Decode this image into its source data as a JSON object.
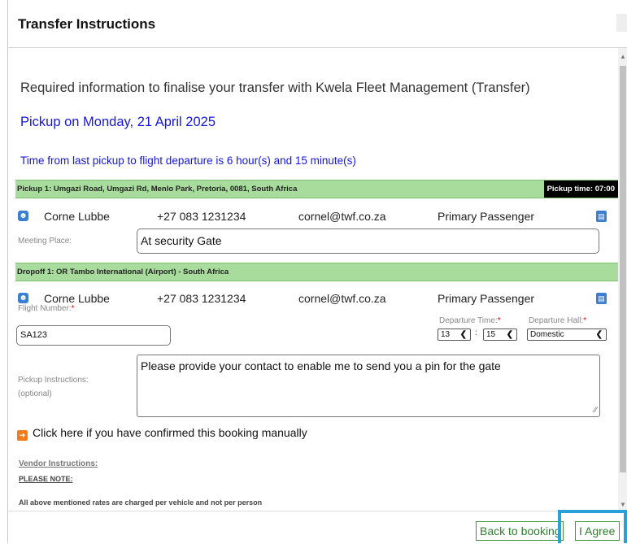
{
  "dialog": {
    "title": "Transfer Instructions"
  },
  "intro": {
    "required_info": "Required information to finalise your transfer with Kwela Fleet Management (Transfer)",
    "pickup_date": "Pickup on Monday, 21 April 2025",
    "time_note": "Time from last pickup to flight departure is 6 hour(s) and 15 minute(s)"
  },
  "pickup": {
    "header": "Pickup 1: Umgazi Road, Umgazi Rd, Menlo Park, Pretoria, 0081, South Africa",
    "pickup_time": "Pickup time: 07:00",
    "passenger": {
      "name": "Corne Lubbe",
      "phone": "+27 083 1231234",
      "email": "cornel@twf.co.za",
      "role": "Primary Passenger"
    },
    "meeting_place_label": "Meeting Place:",
    "meeting_place_value": "At security Gate"
  },
  "dropoff": {
    "header": "Dropoff 1: OR Tambo International (Airport) - South Africa",
    "passenger": {
      "name": "Corne Lubbe",
      "phone": "+27 083 1231234",
      "email": "cornel@twf.co.za",
      "role": "Primary Passenger"
    },
    "flight_number_label": "Flight Number:",
    "flight_number_value": "SA123",
    "departure_time_label": "Departure Time:",
    "departure_hour": "13",
    "departure_minute": "15",
    "time_separator": ":",
    "departure_hall_label": "Departure Hall:",
    "departure_hall_value": "Domestic",
    "required_mark": "*"
  },
  "instructions": {
    "label": "Pickup Instructions:",
    "optional": "(optional)",
    "value": "Please provide your contact to enable me to send you a pin for the gate"
  },
  "confirm_link": "Click here if you have confirmed this booking manually",
  "vendor": {
    "heading": "Vendor Instructions:",
    "please_note": "PLEASE NOTE:",
    "note_text": "All above mentioned rates are charged per vehicle and not per person"
  },
  "footer": {
    "back_label": "Back to booking",
    "agree_label": "I Agree"
  },
  "colors": {
    "green_bar": "#a8dc9c",
    "accent_blue": "#1515e0",
    "highlight": "#2aa0d8"
  },
  "icons": {
    "passenger": "user-icon",
    "delete": "trash-icon",
    "confirm": "manual-confirm-icon"
  }
}
